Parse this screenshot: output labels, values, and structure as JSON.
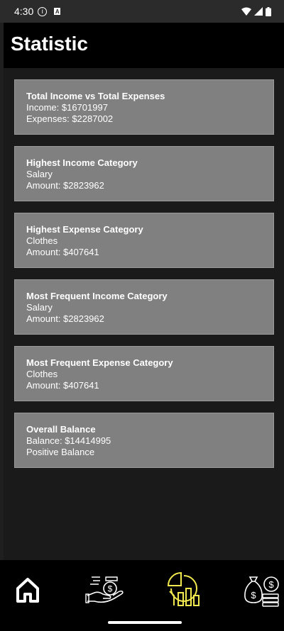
{
  "status_bar": {
    "time": "4:30"
  },
  "app_bar": {
    "title": "Statistic"
  },
  "cards": [
    {
      "title": "Total Income vs Total Expenses",
      "line1": "Income: $16701997",
      "line2": "Expenses: $2287002"
    },
    {
      "title": "Highest Income Category",
      "line1": "Salary",
      "line2": "Amount: $2823962"
    },
    {
      "title": "Highest Expense Category",
      "line1": "Clothes",
      "line2": "Amount: $407641"
    },
    {
      "title": "Most Frequent Income Category",
      "line1": "Salary",
      "line2": "Amount: $2823962"
    },
    {
      "title": "Most Frequent Expense Category",
      "line1": "Clothes",
      "line2": "Amount: $407641"
    },
    {
      "title": "Overall Balance",
      "line1": "Balance: $14414995",
      "line2": "Positive Balance"
    }
  ],
  "bottom_nav": {
    "items": [
      {
        "icon": "home-icon",
        "active": false
      },
      {
        "icon": "income-hand-icon",
        "active": false
      },
      {
        "icon": "statistics-chart-icon",
        "active": true
      },
      {
        "icon": "money-bag-icon",
        "active": false
      }
    ]
  },
  "colors": {
    "active": "#f2e94e",
    "inactive": "#ffffff",
    "card": "#808080"
  }
}
